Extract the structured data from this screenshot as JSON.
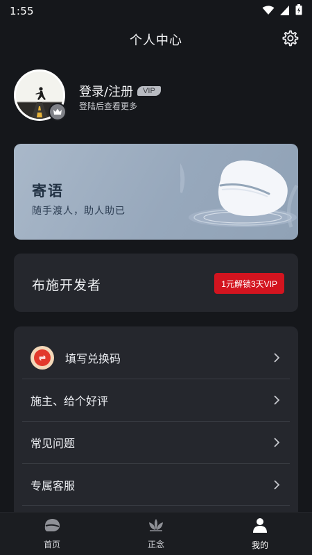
{
  "status_bar": {
    "time": "1:55"
  },
  "header": {
    "title": "个人中心"
  },
  "profile": {
    "login_label": "登录/注册",
    "vip_badge": "VIP",
    "subtitle": "登陆后查看更多"
  },
  "banner": {
    "title": "寄语",
    "subtitle": "随手渡人，助人助已"
  },
  "donate": {
    "title": "布施开发者",
    "button_label": "1元解锁3天VIP"
  },
  "menu": {
    "items": [
      {
        "label": "填写兑换码",
        "icon": "coupon-icon"
      },
      {
        "label": "施主、给个好评"
      },
      {
        "label": "常见问题"
      },
      {
        "label": "专属客服"
      }
    ]
  },
  "bottom_nav": {
    "items": [
      {
        "label": "首页",
        "icon": "home-icon"
      },
      {
        "label": "正念",
        "icon": "lotus-icon"
      },
      {
        "label": "我的",
        "icon": "user-icon",
        "active": true
      }
    ]
  },
  "colors": {
    "background": "#15171b",
    "card": "#25272d",
    "accent_red": "#d3141f",
    "banner": "#a9b8c9"
  }
}
